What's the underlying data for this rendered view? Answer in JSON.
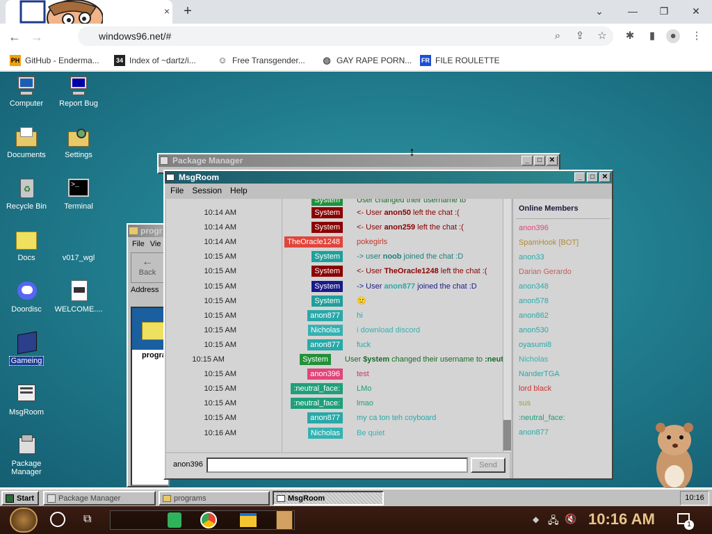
{
  "browser": {
    "url": "windows96.net/#",
    "tab_close": "×",
    "new_tab": "+",
    "window_controls": [
      "⌄",
      "—",
      "❐",
      "✕"
    ],
    "bookmarks": [
      {
        "label": "GitHub - Enderma...",
        "icon": "PH",
        "color": "#f59e0b"
      },
      {
        "label": "Index of ~dartz/i...",
        "icon": "34",
        "color": "#222222"
      },
      {
        "label": "Free Transgender...",
        "icon": "globe-icon",
        "color": "#555555"
      },
      {
        "label": "GAY RAPE PORN...",
        "icon": "globe-icon",
        "color": "#555555"
      },
      {
        "label": "FILE ROULETTE",
        "icon": "FR",
        "color": "#1d4ed8"
      }
    ]
  },
  "desktop": {
    "icons": [
      {
        "label": "Computer"
      },
      {
        "label": "Report Bug"
      },
      {
        "label": "Documents"
      },
      {
        "label": "Settings"
      },
      {
        "label": "Recycle Bin"
      },
      {
        "label": "Terminal"
      },
      {
        "label": "Docs"
      },
      {
        "label": "v017_wgl"
      },
      {
        "label": "Doordisc"
      },
      {
        "label": "WELCOME...."
      },
      {
        "label": "Gameing"
      },
      {
        "label": "MsgRoom"
      },
      {
        "label": "Package Manager"
      }
    ]
  },
  "package_manager": {
    "title": "Package Manager"
  },
  "programs_window": {
    "title": "progr",
    "menu": [
      "File",
      "Vie"
    ],
    "back_label": "Back",
    "address_label": "Address",
    "folder_label": "progra"
  },
  "msgroom": {
    "title": "MsgRoom",
    "menu": [
      "File",
      "Session",
      "Help"
    ],
    "partial_top": "User                  changed their username to",
    "messages": [
      {
        "time": "10:14 AM",
        "nick": "System",
        "nick_color": "#8b0000",
        "prefix": "<- User ",
        "user": "anon50",
        "suffix": " left the chat :(",
        "text_color": "#8b0000"
      },
      {
        "time": "10:14 AM",
        "nick": "System",
        "nick_color": "#8b0000",
        "prefix": "<- User ",
        "user": "anon259",
        "suffix": " left the chat :(",
        "text_color": "#8b0000"
      },
      {
        "time": "10:14 AM",
        "nick": "TheOracle1248",
        "nick_color": "#e0453c",
        "prefix": "pokegirls",
        "user": "",
        "suffix": "",
        "text_color": "#c0392b"
      },
      {
        "time": "10:15 AM",
        "nick": "System",
        "nick_color": "#1f9f9a",
        "prefix": "-> user ",
        "user": "noob",
        "suffix": " joined the chat :D",
        "text_color": "#1f7f7a"
      },
      {
        "time": "10:15 AM",
        "nick": "System",
        "nick_color": "#8b0000",
        "prefix": "<- User ",
        "user": "TheOracle1248",
        "suffix": " left the chat :(",
        "text_color": "#8b0000"
      },
      {
        "time": "10:15 AM",
        "nick": "System",
        "nick_color": "#1a1a8a",
        "prefix": "-> User ",
        "user": "anon877",
        "suffix": " joined the chat :D",
        "text_color": "#1a1a8a",
        "user_color": "#2aa8a8"
      },
      {
        "time": "10:15 AM",
        "nick": "System",
        "nick_color": "#1f9f9a",
        "prefix": "🙂",
        "user": "",
        "suffix": "",
        "text_color": "#1f7f7a"
      },
      {
        "time": "10:15 AM",
        "nick": "anon877",
        "nick_color": "#2aa8a8",
        "prefix": "hi",
        "user": "",
        "suffix": "",
        "text_color": "#2aa8a8"
      },
      {
        "time": "10:15 AM",
        "nick": "Nicholas",
        "nick_color": "#35b2b2",
        "prefix": "i download discord",
        "user": "",
        "suffix": "",
        "text_color": "#35b2b2"
      },
      {
        "time": "10:15 AM",
        "nick": "anon877",
        "nick_color": "#2aa8a8",
        "prefix": "fuck",
        "user": "",
        "suffix": "",
        "text_color": "#2aa8a8"
      },
      {
        "time": "10:15 AM",
        "nick": "System",
        "nick_color": "#22913a",
        "prefix": "User ",
        "user": "$ystem",
        "suffix": " changed their username to ",
        "user2": ":neutral_face:",
        "text_color": "#1a6a2a"
      },
      {
        "time": "10:15 AM",
        "nick": "anon396",
        "nick_color": "#e0457a",
        "prefix": "test",
        "user": "",
        "suffix": "",
        "text_color": "#d0306a"
      },
      {
        "time": "10:15 AM",
        "nick": ":neutral_face:",
        "nick_color": "#1f9f7a",
        "prefix": "LMo",
        "user": "",
        "suffix": "",
        "text_color": "#1f9f7a"
      },
      {
        "time": "10:15 AM",
        "nick": ":neutral_face:",
        "nick_color": "#1f9f7a",
        "prefix": "lmao",
        "user": "",
        "suffix": "",
        "text_color": "#1f9f7a"
      },
      {
        "time": "10:15 AM",
        "nick": "anon877",
        "nick_color": "#2aa8a8",
        "prefix": "my ca ton teh coyboard",
        "user": "",
        "suffix": "",
        "text_color": "#2aa8a8"
      },
      {
        "time": "10:16 AM",
        "nick": "Nicholas",
        "nick_color": "#35b2b2",
        "prefix": "Be quiet",
        "user": "",
        "suffix": "",
        "text_color": "#35b2b2"
      }
    ],
    "input": {
      "username": "anon396",
      "value": "",
      "send_label": "Send"
    },
    "members_heading": "Online Members",
    "members": [
      {
        "name": "anon396",
        "color": "#e0457a"
      },
      {
        "name": "SpamHook [BOT]",
        "color": "#b08a3a"
      },
      {
        "name": "anon33",
        "color": "#2aa8a8"
      },
      {
        "name": "Darian Gerardo",
        "color": "#c06060"
      },
      {
        "name": "anon348",
        "color": "#2aa8a8"
      },
      {
        "name": "anon578",
        "color": "#2aa8a8"
      },
      {
        "name": "anon862",
        "color": "#2aa8a8"
      },
      {
        "name": "anon530",
        "color": "#2aa8a8"
      },
      {
        "name": "oyasumi8",
        "color": "#2aa8a8"
      },
      {
        "name": "Nicholas",
        "color": "#35b2b2"
      },
      {
        "name": "NanderTGA",
        "color": "#2aa8a8"
      },
      {
        "name": "lord black",
        "color": "#d03030"
      },
      {
        "name": "sus",
        "color": "#a0a040"
      },
      {
        "name": ":neutral_face:",
        "color": "#1f9f7a"
      },
      {
        "name": "anon877",
        "color": "#2aa8a8"
      }
    ]
  },
  "taskbar98": {
    "start_label": "Start",
    "tasks": [
      "Package Manager",
      "programs",
      "MsgRoom"
    ],
    "clock": "10:16"
  },
  "windows_taskbar": {
    "clock": "10:16 AM",
    "notif_count": "1"
  }
}
